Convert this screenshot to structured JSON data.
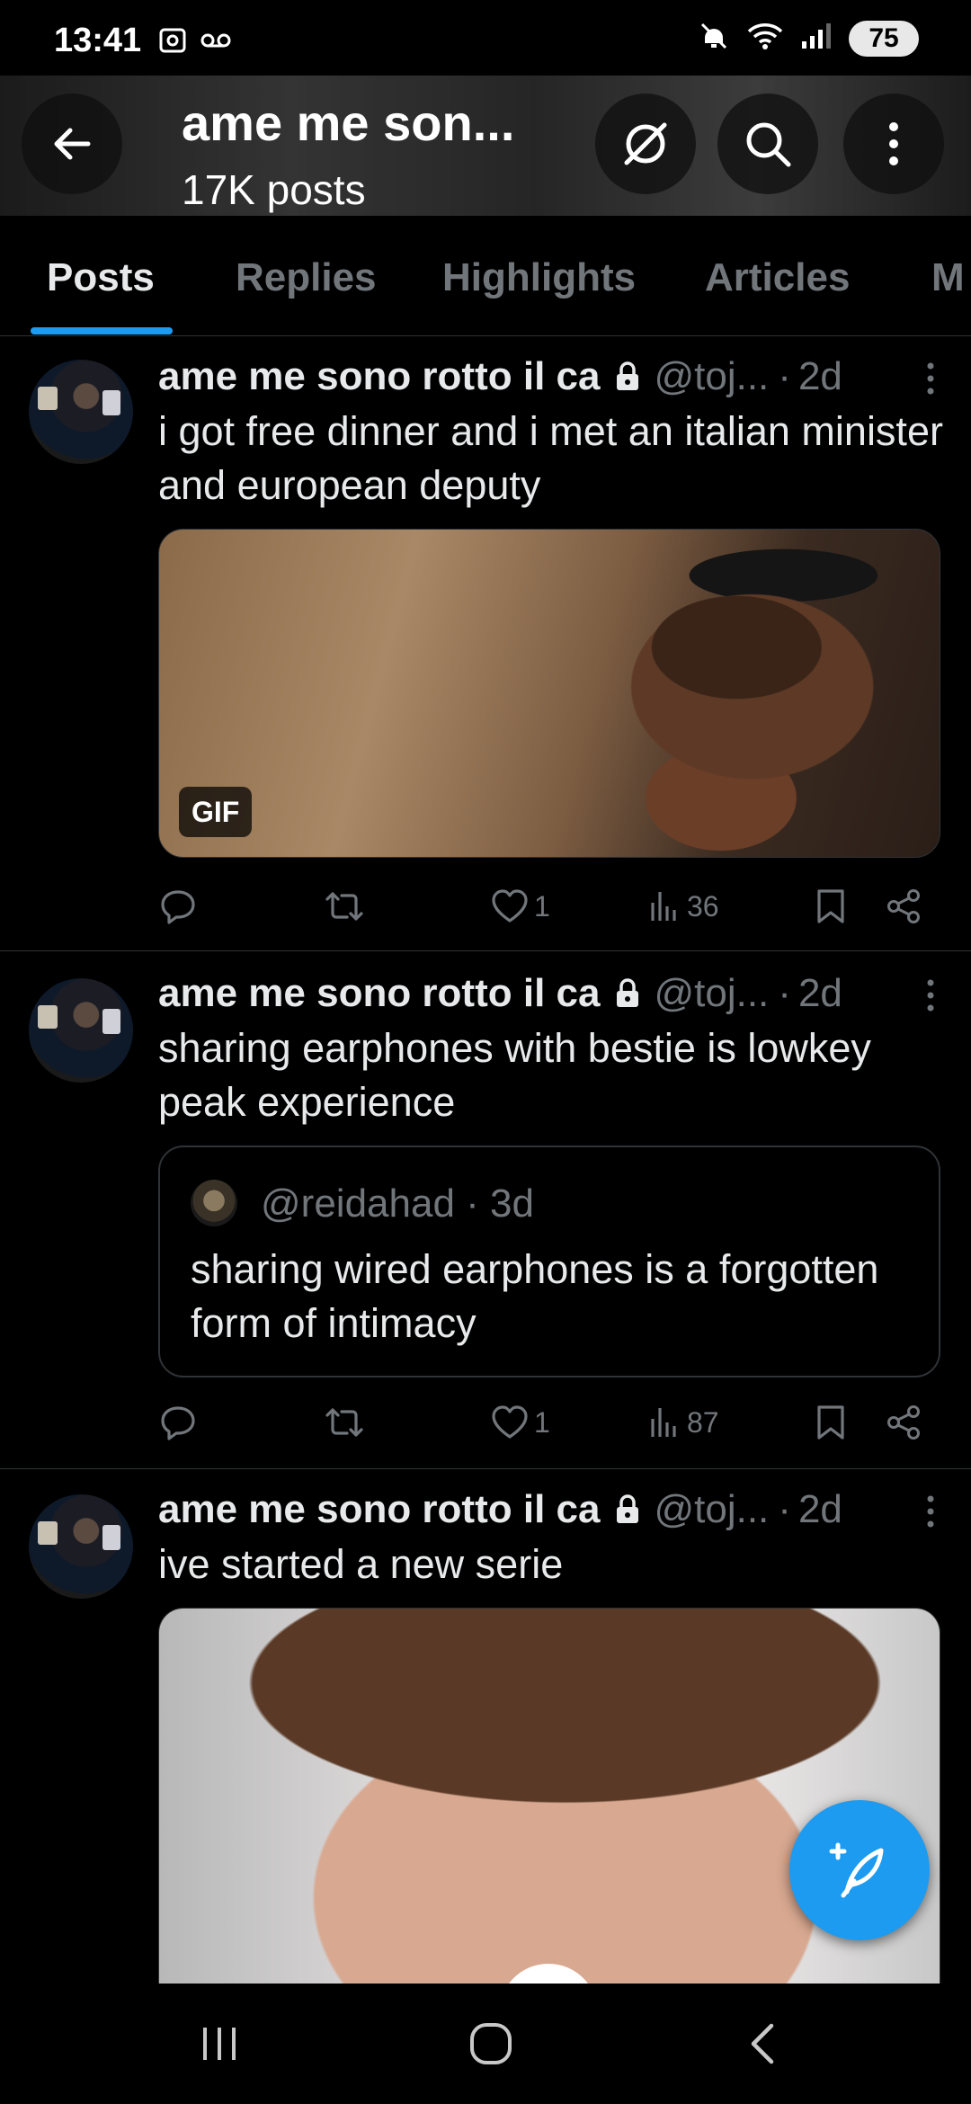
{
  "status_bar": {
    "time": "13:41",
    "battery": "75",
    "icons": [
      "screenshot-icon",
      "voicemail-icon",
      "mute-icon",
      "wifi-icon",
      "signal-icon",
      "battery-icon"
    ]
  },
  "header": {
    "title": "ame me son...",
    "post_count": "17K posts",
    "buttons": [
      "back-icon",
      "grok-icon",
      "search-icon",
      "more-icon"
    ]
  },
  "tabs": [
    {
      "label": "Posts",
      "active": true
    },
    {
      "label": "Replies",
      "active": false
    },
    {
      "label": "Highlights",
      "active": false
    },
    {
      "label": "Articles",
      "active": false
    },
    {
      "label": "M",
      "active": false
    }
  ],
  "posts": [
    {
      "author": "ame me sono rotto il ca",
      "handle": "@toj...",
      "dot": "·",
      "time": "2d",
      "text": "i got free dinner and i met an italian minister and european deputy",
      "media_badge": "GIF",
      "actions": {
        "reply": "",
        "repost": "",
        "likes": "1",
        "views": "36"
      }
    },
    {
      "author": "ame me sono rotto il ca",
      "handle": "@toj...",
      "dot": "·",
      "time": "2d",
      "text": "sharing earphones with bestie is lowkey peak experience",
      "quote": {
        "handle": "@reidahad",
        "dot": "·",
        "time": "3d",
        "text": "sharing wired earphones is a forgotten form of intimacy"
      },
      "actions": {
        "reply": "",
        "repost": "",
        "likes": "1",
        "views": "87"
      }
    },
    {
      "author": "ame me sono rotto il ca",
      "handle": "@toj...",
      "dot": "·",
      "time": "2d",
      "text": "ive started a new serie"
    }
  ],
  "colors": {
    "accent": "#1d9bf0",
    "background": "#000000",
    "text_primary": "#e7e9ea",
    "text_secondary": "#71767b",
    "divider": "#2f3336"
  }
}
